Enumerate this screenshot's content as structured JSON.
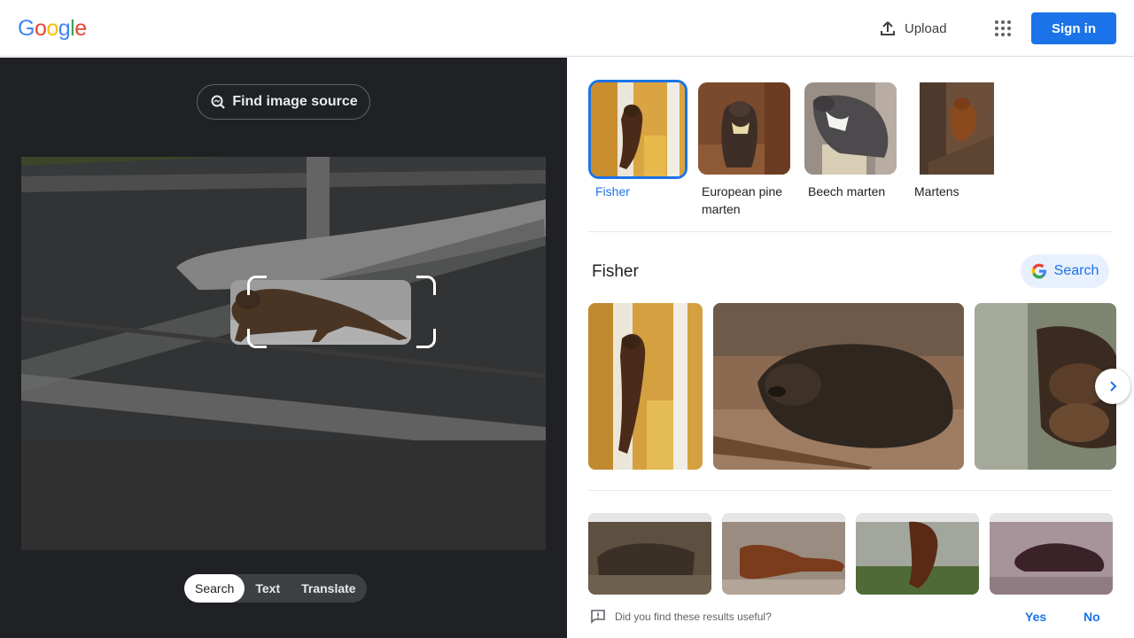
{
  "header": {
    "logo_letters": [
      {
        "ch": "G",
        "color": "#4285F4"
      },
      {
        "ch": "o",
        "color": "#EA4335"
      },
      {
        "ch": "o",
        "color": "#FBBC05"
      },
      {
        "ch": "g",
        "color": "#4285F4"
      },
      {
        "ch": "l",
        "color": "#34A853"
      },
      {
        "ch": "e",
        "color": "#EA4335"
      }
    ],
    "upload_label": "Upload",
    "upload_icon": "upload-icon",
    "apps_icon": "apps-grid-icon",
    "signin_label": "Sign in"
  },
  "lens": {
    "find_source_label": "Find image source",
    "tabs": [
      {
        "label": "Search",
        "active": true
      },
      {
        "label": "Text",
        "active": false
      },
      {
        "label": "Translate",
        "active": false
      }
    ]
  },
  "results": {
    "chips": [
      {
        "label": "Fisher",
        "selected": true
      },
      {
        "label": "European pine marten",
        "selected": false
      },
      {
        "label": "Beech marten",
        "selected": false
      },
      {
        "label": "Martens",
        "selected": false
      }
    ],
    "section_title": "Fisher",
    "search_button_label": "Search",
    "next_icon": "chevron-right-icon",
    "feedback": {
      "question": "Did you find these results useful?",
      "yes": "Yes",
      "no": "No"
    }
  },
  "colors": {
    "accent": "#1a73e8",
    "dark_pane": "#202124"
  }
}
